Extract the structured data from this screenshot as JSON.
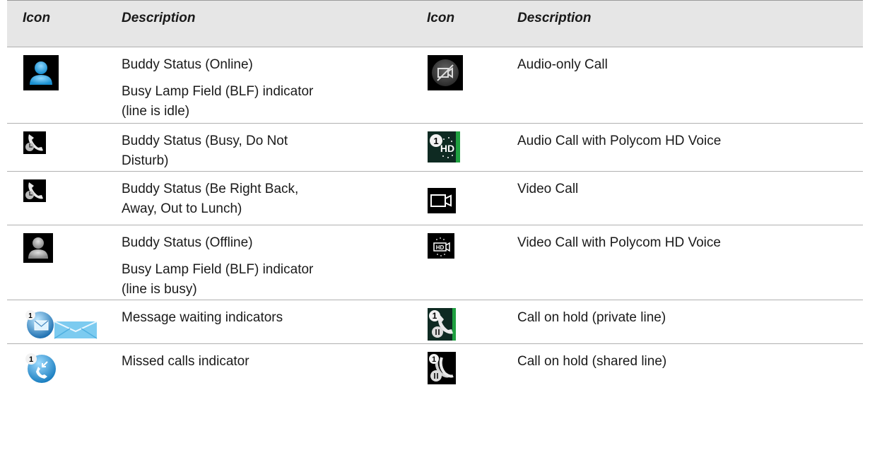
{
  "headers": [
    "Icon",
    "Description",
    "Icon",
    "Description"
  ],
  "rows": [
    {
      "left_icon": "buddy-online-icon",
      "left_lines": [
        "Buddy Status (Online)",
        "Busy Lamp Field (BLF) indicator",
        "(line is idle)"
      ],
      "right_icon": "audio-only-call-icon",
      "right_lines": [
        "Audio-only Call"
      ]
    },
    {
      "left_icon": "buddy-busy-icon",
      "left_lines": [
        "Buddy Status (Busy, Do Not",
        "Disturb)"
      ],
      "right_icon": "hd-voice-audio-call-icon",
      "right_lines": [
        "Audio Call with Polycom HD Voice"
      ]
    },
    {
      "left_icon": "buddy-away-icon",
      "left_lines": [
        "Buddy Status (Be Right Back,",
        "Away, Out to Lunch)"
      ],
      "right_icon": "video-call-icon",
      "right_lines": [
        "Video Call"
      ]
    },
    {
      "left_icon": "buddy-offline-icon",
      "left_lines": [
        "Buddy Status (Offline)",
        "Busy Lamp Field (BLF) indicator",
        "(line is busy)"
      ],
      "right_icon": "hd-voice-video-call-icon",
      "right_lines": [
        "Video Call with Polycom HD Voice"
      ]
    },
    {
      "left_icon": "message-waiting-icon",
      "left_lines": [
        "Message waiting indicators"
      ],
      "right_icon": "hold-private-line-icon",
      "right_lines": [
        "Call on hold (private line)"
      ]
    },
    {
      "left_icon": "missed-calls-icon",
      "left_lines": [
        "Missed calls indicator"
      ],
      "right_icon": "hold-shared-line-icon",
      "right_lines": [
        "Call on hold (shared line)"
      ]
    }
  ]
}
